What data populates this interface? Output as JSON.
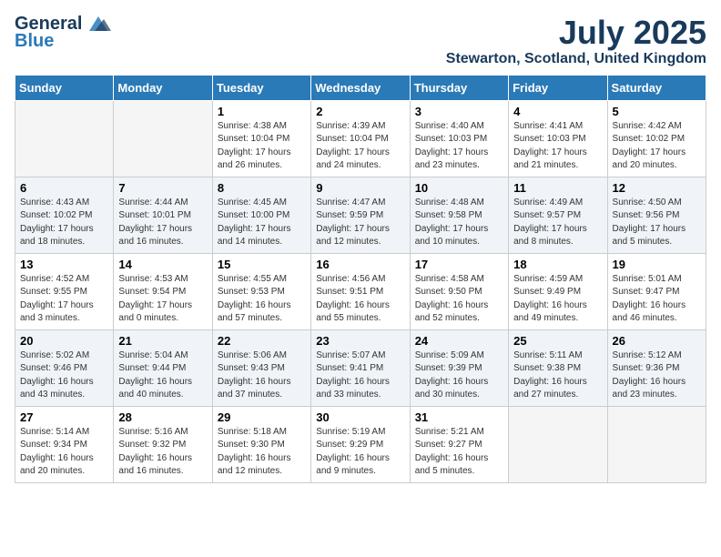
{
  "header": {
    "logo_general": "General",
    "logo_blue": "Blue",
    "month_year": "July 2025",
    "location": "Stewarton, Scotland, United Kingdom"
  },
  "days_of_week": [
    "Sunday",
    "Monday",
    "Tuesday",
    "Wednesday",
    "Thursday",
    "Friday",
    "Saturday"
  ],
  "weeks": [
    [
      {
        "day": "",
        "info": ""
      },
      {
        "day": "",
        "info": ""
      },
      {
        "day": "1",
        "info": "Sunrise: 4:38 AM\nSunset: 10:04 PM\nDaylight: 17 hours and 26 minutes."
      },
      {
        "day": "2",
        "info": "Sunrise: 4:39 AM\nSunset: 10:04 PM\nDaylight: 17 hours and 24 minutes."
      },
      {
        "day": "3",
        "info": "Sunrise: 4:40 AM\nSunset: 10:03 PM\nDaylight: 17 hours and 23 minutes."
      },
      {
        "day": "4",
        "info": "Sunrise: 4:41 AM\nSunset: 10:03 PM\nDaylight: 17 hours and 21 minutes."
      },
      {
        "day": "5",
        "info": "Sunrise: 4:42 AM\nSunset: 10:02 PM\nDaylight: 17 hours and 20 minutes."
      }
    ],
    [
      {
        "day": "6",
        "info": "Sunrise: 4:43 AM\nSunset: 10:02 PM\nDaylight: 17 hours and 18 minutes."
      },
      {
        "day": "7",
        "info": "Sunrise: 4:44 AM\nSunset: 10:01 PM\nDaylight: 17 hours and 16 minutes."
      },
      {
        "day": "8",
        "info": "Sunrise: 4:45 AM\nSunset: 10:00 PM\nDaylight: 17 hours and 14 minutes."
      },
      {
        "day": "9",
        "info": "Sunrise: 4:47 AM\nSunset: 9:59 PM\nDaylight: 17 hours and 12 minutes."
      },
      {
        "day": "10",
        "info": "Sunrise: 4:48 AM\nSunset: 9:58 PM\nDaylight: 17 hours and 10 minutes."
      },
      {
        "day": "11",
        "info": "Sunrise: 4:49 AM\nSunset: 9:57 PM\nDaylight: 17 hours and 8 minutes."
      },
      {
        "day": "12",
        "info": "Sunrise: 4:50 AM\nSunset: 9:56 PM\nDaylight: 17 hours and 5 minutes."
      }
    ],
    [
      {
        "day": "13",
        "info": "Sunrise: 4:52 AM\nSunset: 9:55 PM\nDaylight: 17 hours and 3 minutes."
      },
      {
        "day": "14",
        "info": "Sunrise: 4:53 AM\nSunset: 9:54 PM\nDaylight: 17 hours and 0 minutes."
      },
      {
        "day": "15",
        "info": "Sunrise: 4:55 AM\nSunset: 9:53 PM\nDaylight: 16 hours and 57 minutes."
      },
      {
        "day": "16",
        "info": "Sunrise: 4:56 AM\nSunset: 9:51 PM\nDaylight: 16 hours and 55 minutes."
      },
      {
        "day": "17",
        "info": "Sunrise: 4:58 AM\nSunset: 9:50 PM\nDaylight: 16 hours and 52 minutes."
      },
      {
        "day": "18",
        "info": "Sunrise: 4:59 AM\nSunset: 9:49 PM\nDaylight: 16 hours and 49 minutes."
      },
      {
        "day": "19",
        "info": "Sunrise: 5:01 AM\nSunset: 9:47 PM\nDaylight: 16 hours and 46 minutes."
      }
    ],
    [
      {
        "day": "20",
        "info": "Sunrise: 5:02 AM\nSunset: 9:46 PM\nDaylight: 16 hours and 43 minutes."
      },
      {
        "day": "21",
        "info": "Sunrise: 5:04 AM\nSunset: 9:44 PM\nDaylight: 16 hours and 40 minutes."
      },
      {
        "day": "22",
        "info": "Sunrise: 5:06 AM\nSunset: 9:43 PM\nDaylight: 16 hours and 37 minutes."
      },
      {
        "day": "23",
        "info": "Sunrise: 5:07 AM\nSunset: 9:41 PM\nDaylight: 16 hours and 33 minutes."
      },
      {
        "day": "24",
        "info": "Sunrise: 5:09 AM\nSunset: 9:39 PM\nDaylight: 16 hours and 30 minutes."
      },
      {
        "day": "25",
        "info": "Sunrise: 5:11 AM\nSunset: 9:38 PM\nDaylight: 16 hours and 27 minutes."
      },
      {
        "day": "26",
        "info": "Sunrise: 5:12 AM\nSunset: 9:36 PM\nDaylight: 16 hours and 23 minutes."
      }
    ],
    [
      {
        "day": "27",
        "info": "Sunrise: 5:14 AM\nSunset: 9:34 PM\nDaylight: 16 hours and 20 minutes."
      },
      {
        "day": "28",
        "info": "Sunrise: 5:16 AM\nSunset: 9:32 PM\nDaylight: 16 hours and 16 minutes."
      },
      {
        "day": "29",
        "info": "Sunrise: 5:18 AM\nSunset: 9:30 PM\nDaylight: 16 hours and 12 minutes."
      },
      {
        "day": "30",
        "info": "Sunrise: 5:19 AM\nSunset: 9:29 PM\nDaylight: 16 hours and 9 minutes."
      },
      {
        "day": "31",
        "info": "Sunrise: 5:21 AM\nSunset: 9:27 PM\nDaylight: 16 hours and 5 minutes."
      },
      {
        "day": "",
        "info": ""
      },
      {
        "day": "",
        "info": ""
      }
    ]
  ]
}
